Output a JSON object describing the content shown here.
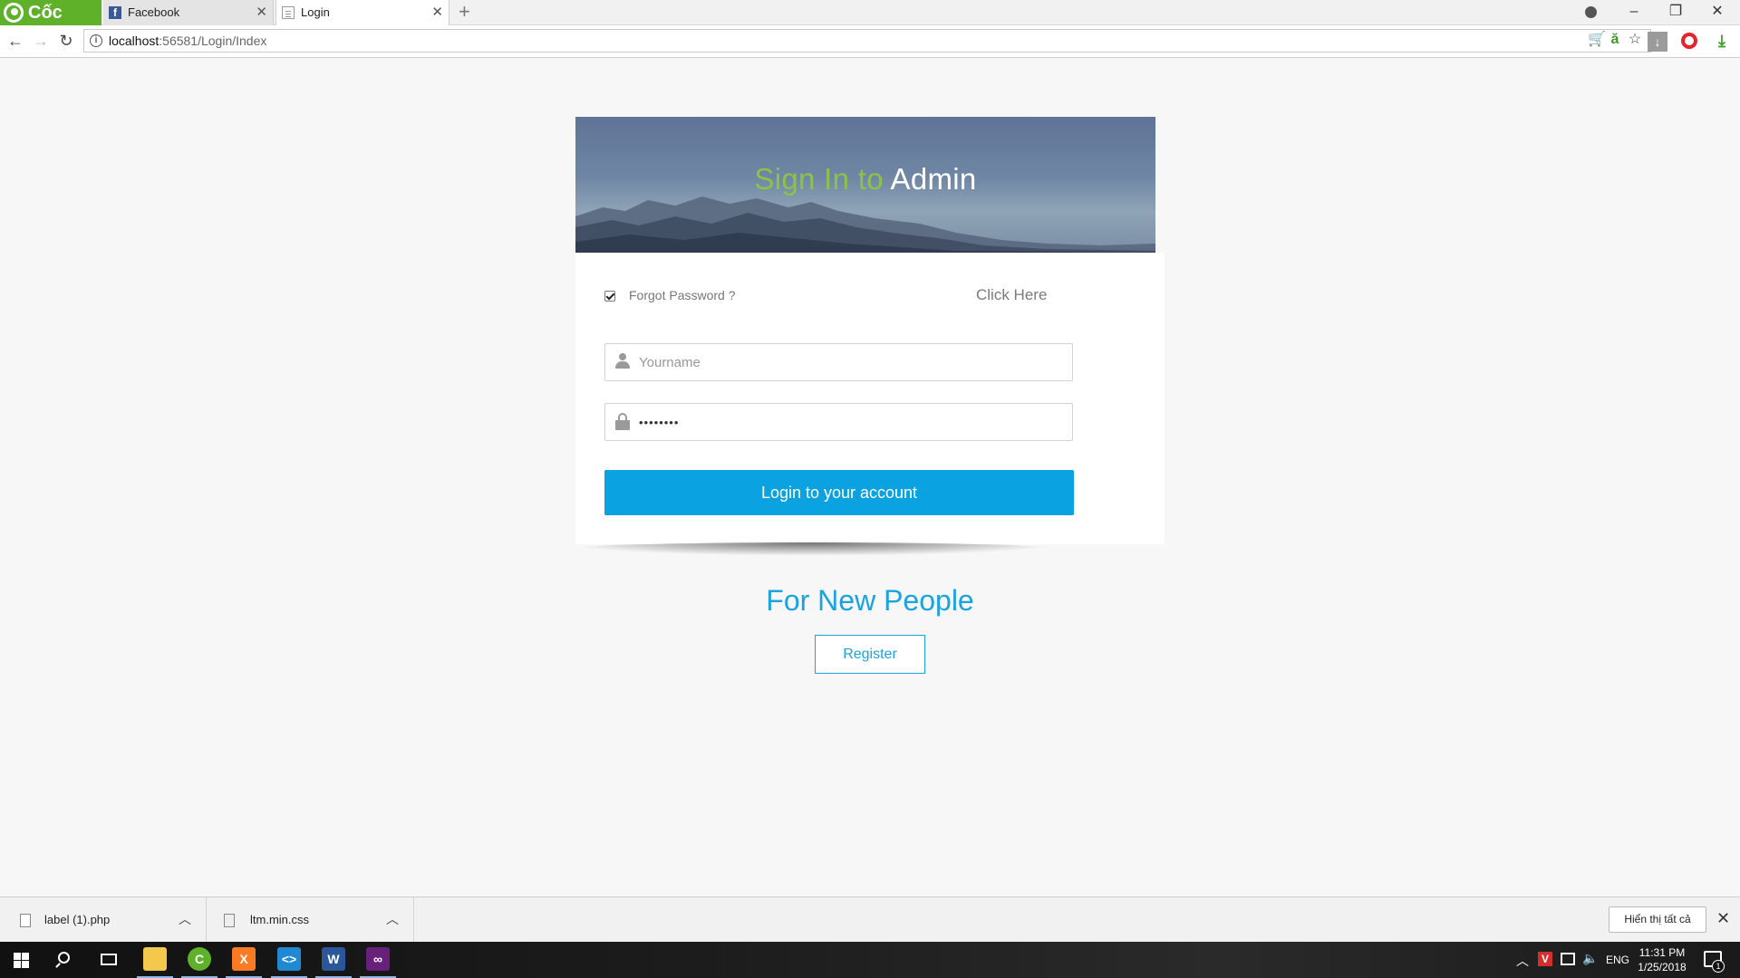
{
  "browser": {
    "brand_name": "Cốc Cốc",
    "tabs": [
      {
        "label": "Facebook",
        "favicon": "facebook-icon",
        "active": false
      },
      {
        "label": "Login",
        "favicon": "page-icon",
        "active": true
      }
    ],
    "new_tab_glyph": "+",
    "address": {
      "host": "localhost",
      "path": ":56581/Login/Index"
    },
    "window_controls": {
      "minimize": "–",
      "maximize": "❐",
      "close": "✕"
    }
  },
  "login": {
    "title_prefix": "Sign In to",
    "title_suffix": "Admin",
    "remember_checked": true,
    "forgot_label": "Forgot Password ?",
    "click_here_label": "Click Here",
    "username_placeholder": "Yourname",
    "password_value": "••••••••",
    "submit_label": "Login to your account",
    "new_people_heading": "For New People",
    "register_label": "Register"
  },
  "downloads": {
    "items": [
      {
        "file_name": "label (1).php"
      },
      {
        "file_name": "ltm.min.css"
      }
    ],
    "show_all_label": "Hiển thị tất cả",
    "close_glyph": "✕"
  },
  "taskbar": {
    "language": "ENG",
    "time": "11:31 PM",
    "date": "1/25/2018",
    "notification_count": "1"
  },
  "colors": {
    "title_green": "#8bc34a",
    "accent_blue": "#0aa2e0",
    "brand_green": "#5fb12a"
  }
}
